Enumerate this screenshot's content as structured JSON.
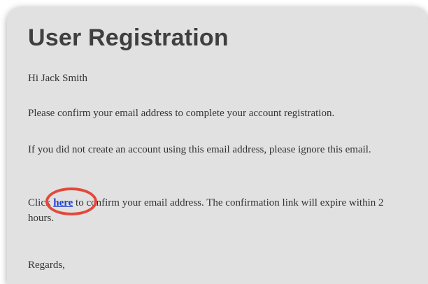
{
  "email": {
    "title": "User Registration",
    "greeting": "Hi Jack Smith",
    "confirm_message": "Please confirm your email address to complete your account registration.",
    "ignore_message": "If you did not create an account using this email address, please ignore this email.",
    "click_prefix": "Click ",
    "link_text": "here",
    "click_suffix": " to confirm your email address. The confirmation link will expire within 2 hours.",
    "sign_off": "Regards,"
  },
  "colors": {
    "card_background": "#e1e1e1",
    "link": "#1f3fd1",
    "annotation_circle": "#e2493c"
  }
}
